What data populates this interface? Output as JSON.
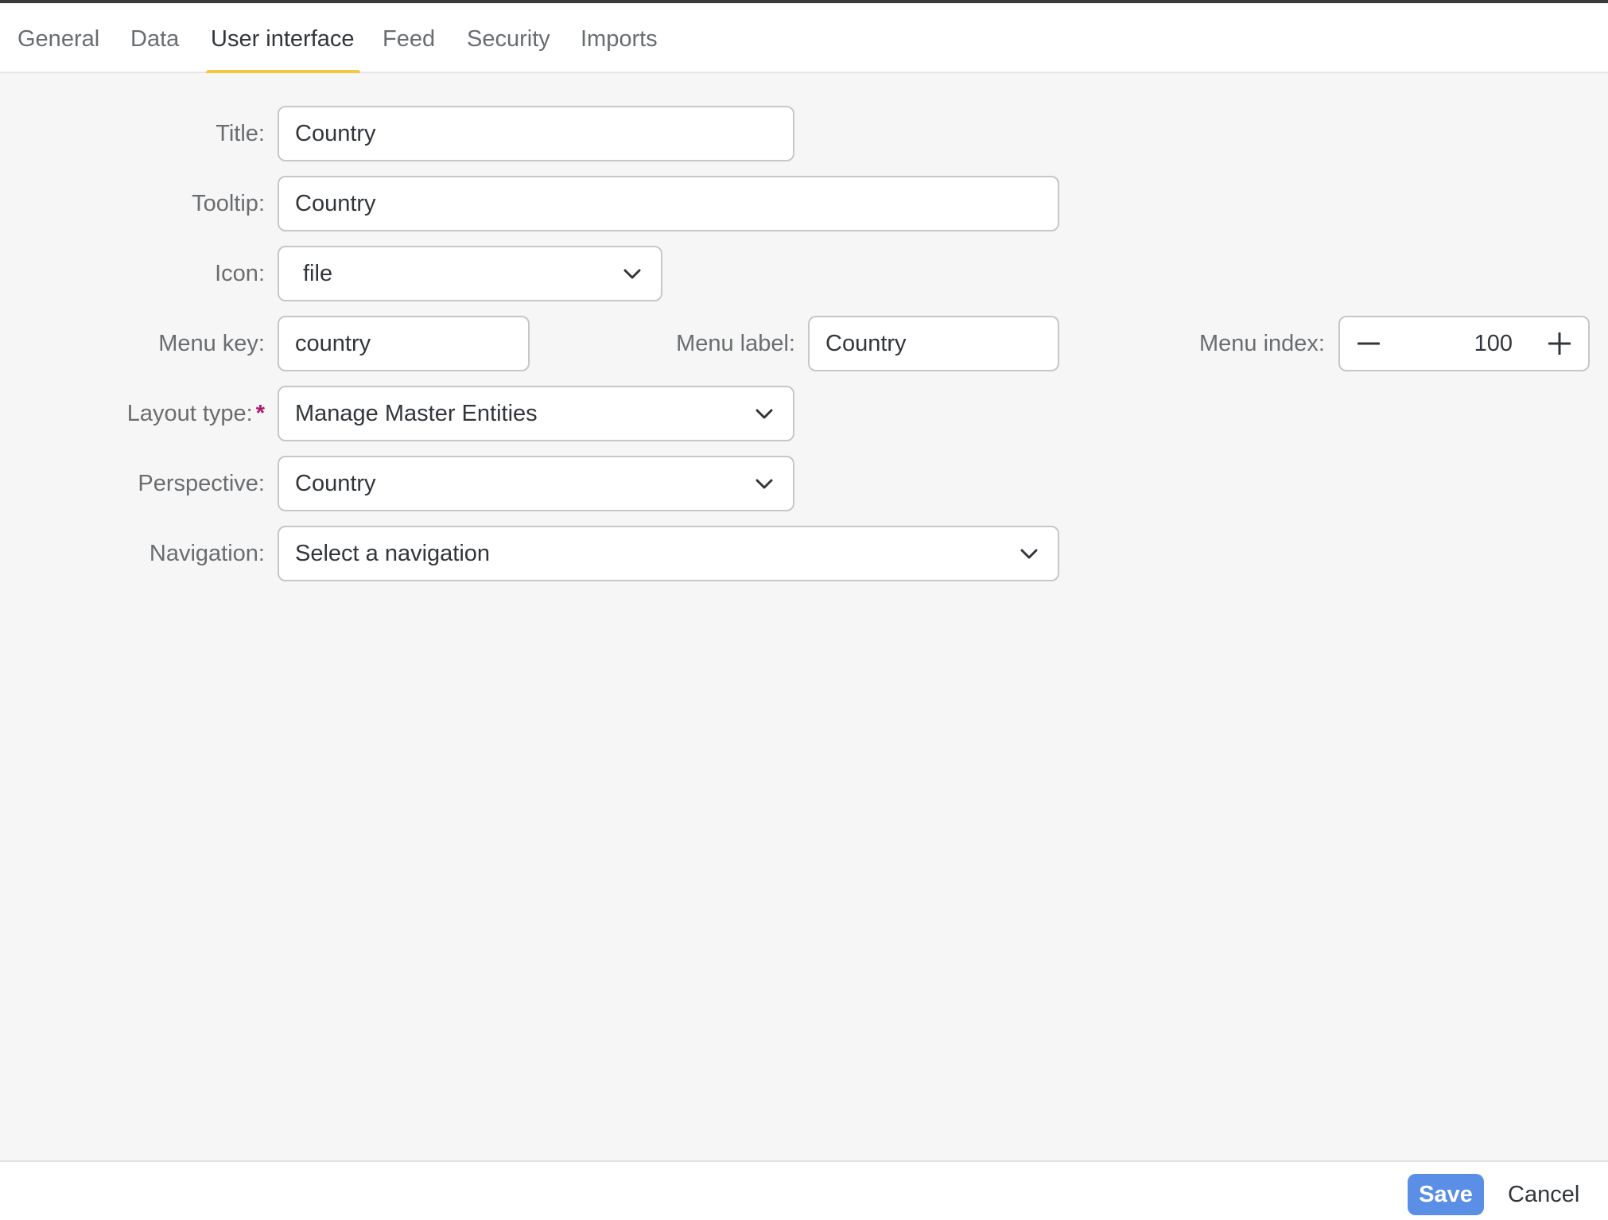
{
  "tabs": [
    {
      "label": "General",
      "active": false
    },
    {
      "label": "Data",
      "active": false
    },
    {
      "label": "User interface",
      "active": true
    },
    {
      "label": "Feed",
      "active": false
    },
    {
      "label": "Security",
      "active": false
    },
    {
      "label": "Imports",
      "active": false
    }
  ],
  "form": {
    "title": {
      "label": "Title:",
      "value": "Country"
    },
    "tooltip": {
      "label": "Tooltip:",
      "value": "Country"
    },
    "icon": {
      "label": "Icon:",
      "value": "file"
    },
    "menu_key": {
      "label": "Menu key:",
      "value": "country"
    },
    "menu_label": {
      "label": "Menu label:",
      "value": "Country"
    },
    "menu_index": {
      "label": "Menu index:",
      "value": "100"
    },
    "layout_type": {
      "label": "Layout type:",
      "required_mark": "*",
      "value": "Manage Master Entities"
    },
    "perspective": {
      "label": "Perspective:",
      "value": "Country"
    },
    "navigation": {
      "label": "Navigation:",
      "value": "Select a navigation"
    }
  },
  "footer": {
    "save_label": "Save",
    "cancel_label": "Cancel"
  },
  "colors": {
    "active_tab_indicator": "#f5c842",
    "primary_button": "#5b8fe5",
    "required_mark": "#b0176d"
  }
}
